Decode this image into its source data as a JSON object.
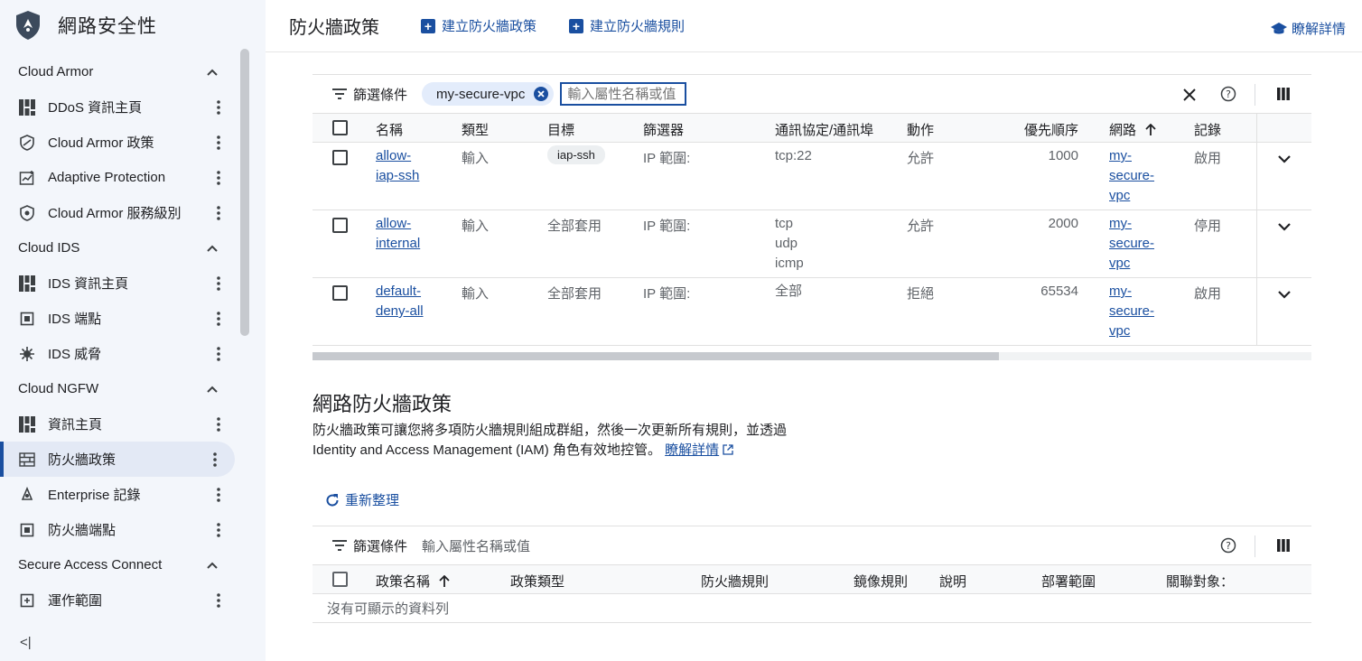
{
  "app": {
    "title": "網路安全性"
  },
  "sidebar": {
    "sections": [
      {
        "title": "Cloud Armor",
        "items": [
          {
            "label": "DDoS 資訊主頁",
            "icon": "dashboard-icon"
          },
          {
            "label": "Cloud Armor 政策",
            "icon": "shield-policy-icon"
          },
          {
            "label": "Adaptive Protection",
            "icon": "adaptive-chart-icon"
          },
          {
            "label": "Cloud Armor 服務級別",
            "icon": "shield-tier-icon"
          }
        ]
      },
      {
        "title": "Cloud IDS",
        "items": [
          {
            "label": "IDS 資訊主頁",
            "icon": "dashboard-icon"
          },
          {
            "label": "IDS 端點",
            "icon": "endpoint-icon"
          },
          {
            "label": "IDS 威脅",
            "icon": "threat-icon"
          }
        ]
      },
      {
        "title": "Cloud NGFW",
        "items": [
          {
            "label": "資訊主頁",
            "icon": "dashboard-icon"
          },
          {
            "label": "防火牆政策",
            "icon": "firewall-icon",
            "active": true
          },
          {
            "label": "Enterprise 記錄",
            "icon": "log-icon"
          },
          {
            "label": "防火牆端點",
            "icon": "endpoint-icon"
          }
        ]
      },
      {
        "title": "Secure Access Connect",
        "items": [
          {
            "label": "運作範圍",
            "icon": "scope-icon"
          }
        ]
      }
    ],
    "collapse_label": "<|"
  },
  "topbar": {
    "title": "防火牆政策",
    "create_policy": "建立防火牆政策",
    "create_rule": "建立防火牆規則",
    "learn_more": "瞭解詳情"
  },
  "table1": {
    "filter_label": "篩選條件",
    "chip": "my-secure-vpc",
    "placeholder": "輸入屬性名稱或值",
    "columns": [
      "名稱",
      "類型",
      "目標",
      "篩選器",
      "通訊協定/通訊埠",
      "動作",
      "優先順序",
      "網路",
      "記錄"
    ],
    "rows": [
      {
        "name": [
          "allow-",
          "iap-ssh"
        ],
        "type": "輸入",
        "target": "iap-ssh",
        "target_badge": true,
        "filter": "IP 範圍:",
        "proto": [
          "tcp:22"
        ],
        "action": "允許",
        "priority": "1000",
        "network": [
          "my-",
          "secure-",
          "vpc"
        ],
        "log": "啟用"
      },
      {
        "name": [
          "allow-",
          "internal"
        ],
        "type": "輸入",
        "target": "全部套用",
        "target_badge": false,
        "filter": "IP 範圍:",
        "proto": [
          "tcp",
          "udp",
          "icmp"
        ],
        "action": "允許",
        "priority": "2000",
        "network": [
          "my-",
          "secure-",
          "vpc"
        ],
        "log": "停用"
      },
      {
        "name": [
          "default-",
          "deny-all"
        ],
        "type": "輸入",
        "target": "全部套用",
        "target_badge": false,
        "filter": "IP 範圍:",
        "proto": [
          "全部"
        ],
        "action": "拒絕",
        "priority": "65534",
        "network": [
          "my-",
          "secure-",
          "vpc"
        ],
        "log": "啟用"
      }
    ]
  },
  "section2": {
    "title": "網路防火牆政策",
    "desc_line1": "防火牆政策可讓您將多項防火牆規則組成群組，然後一次更新所有規則，並透過",
    "desc_line2": "Identity and Access Management (IAM) 角色有效地控管。",
    "learn_more": "瞭解詳情",
    "refresh": "重新整理"
  },
  "table2": {
    "filter_label": "篩選條件",
    "placeholder": "輸入屬性名稱或值",
    "columns": [
      "政策名稱",
      "政策類型",
      "防火牆規則",
      "鏡像規則",
      "說明",
      "部署範圍",
      "關聯對象："
    ],
    "empty": "沒有可顯示的資料列"
  },
  "colors": {
    "accent": "#1a4fa0",
    "sidebar_bg": "#f3f6fb"
  }
}
